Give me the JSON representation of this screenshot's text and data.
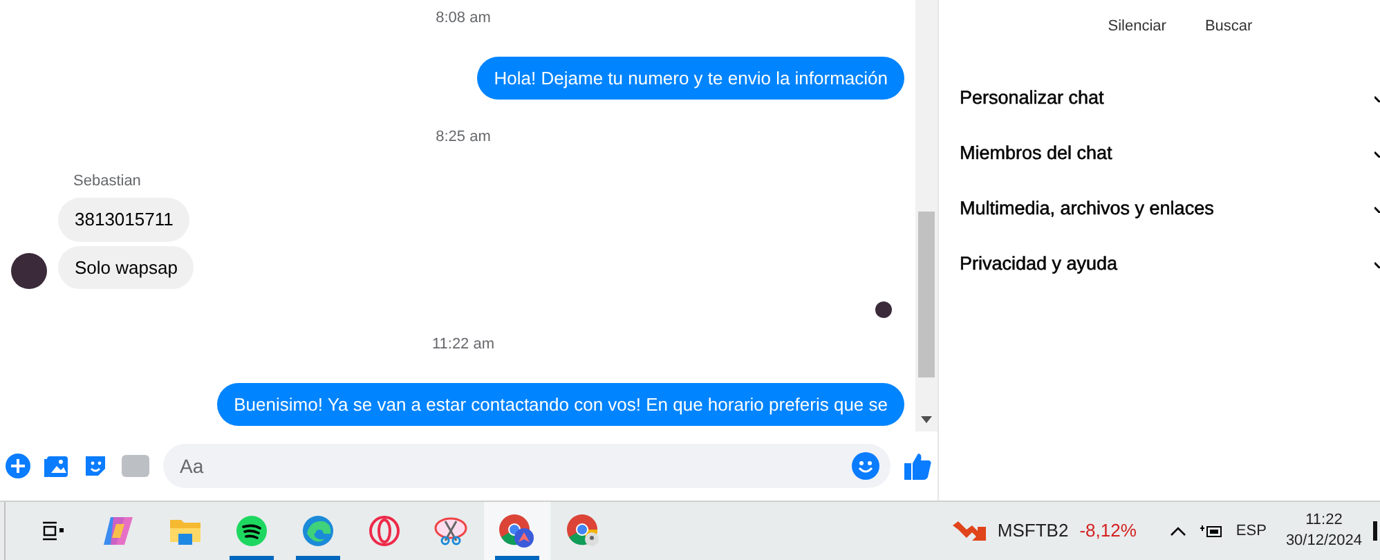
{
  "chat": {
    "items": [
      {
        "kind": "time",
        "text": "8:08 am"
      },
      {
        "kind": "sent",
        "text": "Hola! Dejame tu numero y te envio la información"
      },
      {
        "kind": "time",
        "text": "8:25 am"
      },
      {
        "kind": "sender",
        "text": "Sebastian"
      },
      {
        "kind": "received",
        "text": "3813015711",
        "avatar": false
      },
      {
        "kind": "received",
        "text": "Solo wapsap",
        "avatar": true
      },
      {
        "kind": "seen"
      },
      {
        "kind": "time",
        "text": "11:22 am"
      },
      {
        "kind": "sent",
        "text": "Buenisimo! Ya se van a estar contactando con vos! En que horario preferis que se"
      }
    ]
  },
  "composer": {
    "placeholder": "Aa"
  },
  "details": {
    "actions": [
      "Silenciar",
      "Buscar"
    ],
    "sections": [
      {
        "label": "Personalizar chat",
        "expanded": false
      },
      {
        "label": "Miembros del chat",
        "expanded": false
      },
      {
        "label": "Multimedia, archivos y enlaces",
        "expanded": false
      },
      {
        "label": "Privacidad y ayuda",
        "expanded": false
      }
    ]
  },
  "taskbar": {
    "apps": [
      {
        "kind": "taskview",
        "running": false,
        "selected": false
      },
      {
        "kind": "copilot",
        "running": false,
        "selected": false
      },
      {
        "kind": "files",
        "running": false,
        "selected": false
      },
      {
        "kind": "spotify",
        "running": true,
        "selected": false
      },
      {
        "kind": "edge",
        "running": true,
        "selected": false
      },
      {
        "kind": "opera",
        "running": false,
        "selected": false
      },
      {
        "kind": "snip",
        "running": false,
        "selected": false
      },
      {
        "kind": "chrome-app",
        "running": true,
        "selected": true
      },
      {
        "kind": "chrome-profile",
        "running": false,
        "selected": false
      }
    ],
    "stock": {
      "symbol": "MSFTB2",
      "change": "-8,12%"
    },
    "language": "ESP",
    "time": "11:22",
    "date": "30/12/2024"
  }
}
